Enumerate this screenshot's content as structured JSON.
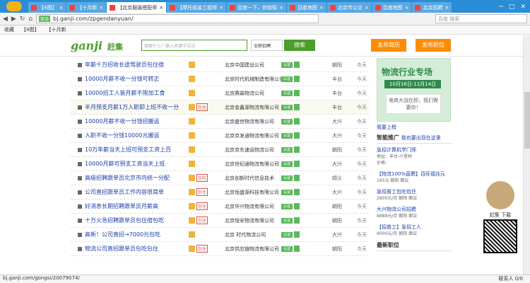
{
  "tabs": [
    {
      "label": "【4图】"
    },
    {
      "label": "【十月新"
    },
    {
      "label": "【北京服装搭配师",
      "active": true
    },
    {
      "label": "【摩托组装工程师"
    },
    {
      "label": "百度一下，你就知"
    },
    {
      "label": "百度地图"
    },
    {
      "label": "北京市公交"
    },
    {
      "label": "百度地图"
    },
    {
      "label": "北京招聘"
    }
  ],
  "address": {
    "secure": "安全",
    "url": "bj.ganji.com/zpgendanyuan/",
    "search_placeholder": "百度 搜索"
  },
  "bookmarks": [
    "收藏",
    "【4图】",
    "【十月新"
  ],
  "site": {
    "logo": "ganji",
    "logo2": "赶集",
    "search_placeholder": "搜索什么？输入关键字试试",
    "category": "全职招聘",
    "search_btn": "搜索",
    "pub1": "发布简历",
    "pub2": "发布职位"
  },
  "listings": [
    {
      "title": "年薪十万招收长途驾驶员包住宿",
      "co": "北京中国建设公司",
      "area": "朝阳",
      "date": "今天",
      "badge": ""
    },
    {
      "title": "10000月薪不收一分钱可转正",
      "co": "北京时代机械制造有限公司",
      "area": "丰台",
      "date": "今天",
      "badge": ""
    },
    {
      "title": "10000招工人装月薪不限加工食",
      "co": "北京赛森物流公司",
      "area": "丰台",
      "date": "今天",
      "badge": ""
    },
    {
      "title": "半月预支月薪1万入职即上班不收一分",
      "co": "北京金鑫源物流有限公司",
      "area": "丰台",
      "date": "今天",
      "badge": "包住",
      "hl": true
    },
    {
      "title": "10000月薪不收一分钱招搬运",
      "co": "北京盛世物流有限公司",
      "area": "大兴",
      "date": "今天",
      "badge": ""
    },
    {
      "title": "入职不收一分钱10000元搬运",
      "co": "北京京发通物流有限公司",
      "area": "大兴",
      "date": "今天",
      "badge": ""
    },
    {
      "title": "10万年薪当天上班可预支工资上百",
      "co": "北京京东速运物流公司",
      "area": "朝阳",
      "date": "今天",
      "badge": ""
    },
    {
      "title": "10000月薪可预支工资当天上班",
      "co": "北京世纪通物流有限公司",
      "area": "大兴",
      "date": "今天",
      "badge": ""
    },
    {
      "title": "高级招聘跟单员北京市内统一分配",
      "co": "北京创新时代信息技术",
      "area": "顺义",
      "date": "今天",
      "badge": "包吃"
    },
    {
      "title": "公司直招跟单员工作内容很简单",
      "co": "北京恒盛源科技有限公司",
      "area": "大兴",
      "date": "今天",
      "badge": "包住"
    },
    {
      "title": "好消息长期招聘跟单员月薪高",
      "co": "北京华兴物流有限公司",
      "area": "朝阳",
      "date": "今天",
      "badge": "包住"
    },
    {
      "title": "十万火急招聘跟单员包住宿包吃",
      "co": "北京恒安物流有限公司",
      "area": "朝阳",
      "date": "今天",
      "badge": "包住"
    },
    {
      "title": "高新！公司直招→7000元包吃",
      "co": "北京 时代物流公司",
      "area": "大兴",
      "date": "今天",
      "badge": ""
    },
    {
      "title": "物流公司直招跟单员包吃包住",
      "co": "北京供应链物流有限公司",
      "area": "朝阳",
      "date": "今天",
      "badge": "包住"
    }
  ],
  "side": {
    "ad_title": "物流行业专场",
    "ad_date": "10月16日-11月14日",
    "ad_sub": "电商大战在即，我们需要你！",
    "link1": "我要上榜",
    "head": "智能推广",
    "head_link": "我也要出现在这里",
    "promo": [
      {
        "title": "急招计算机学门师",
        "meta": "地址：丰台-六里桥",
        "meta2": "价格："
      },
      {
        "title": "【物流100%直聘】百旺福兆元",
        "meta": "165元 朝阳 面议"
      },
      {
        "title": "急招普工包吃包住",
        "meta": "2800元/月 朝阳 面议"
      },
      {
        "title": "大兴物流公司招聘",
        "meta": "8888元/月 朝阳 面议"
      },
      {
        "title": "【招普工】急招工人",
        "meta": "9000元/月 朝阳 面议"
      }
    ],
    "more": "最新职位"
  },
  "qr": {
    "label": "赶集 下载"
  },
  "status": {
    "url": "bj.ganji.com/gongsi/20079074/",
    "palm": "联系人 0/0"
  }
}
